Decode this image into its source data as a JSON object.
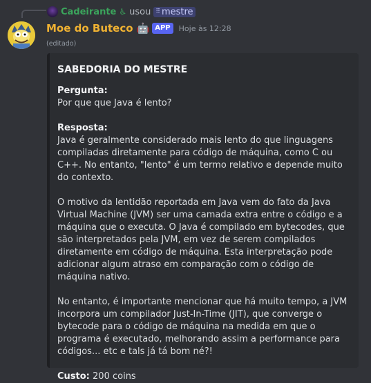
{
  "reply": {
    "user": "Cadeirante",
    "icon": "wheelchair-icon",
    "verb": "usou",
    "command": "mestre"
  },
  "message": {
    "author": "Moe do Buteco",
    "author_color": "#f0b232",
    "badge": "APP",
    "timestamp": "Hoje às 12:28",
    "edited": "(editado)"
  },
  "embed": {
    "title": "SABEDORIA DO MESTRE",
    "question_label": "Pergunta:",
    "question": "Por que que Java é lento?",
    "answer_label": "Resposta:",
    "answer_p1": "Java é geralmente considerado mais lento do que linguagens compiladas diretamente para código de máquina, como C ou C++. No entanto, \"lento\" é um termo relativo e depende muito do contexto.",
    "answer_p2": "O motivo da lentidão reportada em Java vem do fato da Java Virtual Machine (JVM) ser uma camada extra entre o código e a máquina que o executa. O Java é compilado em bytecodes, que são interpretados pela JVM, em vez de serem compilados diretamente em código de máquina. Esta interpretação pode adicionar algum atraso em comparação com o código de máquina nativo.",
    "answer_p3": "No entanto, é importante mencionar que há muito tempo, a JVM incorpora um compilador Just-In-Time (JIT), que converge o bytecode para o código de máquina na medida em que o programa é executado, melhorando assim a performance para códigos... etc e tals já tá bom né?!",
    "cost_label": "Custo:",
    "cost_value": "200 coins"
  }
}
